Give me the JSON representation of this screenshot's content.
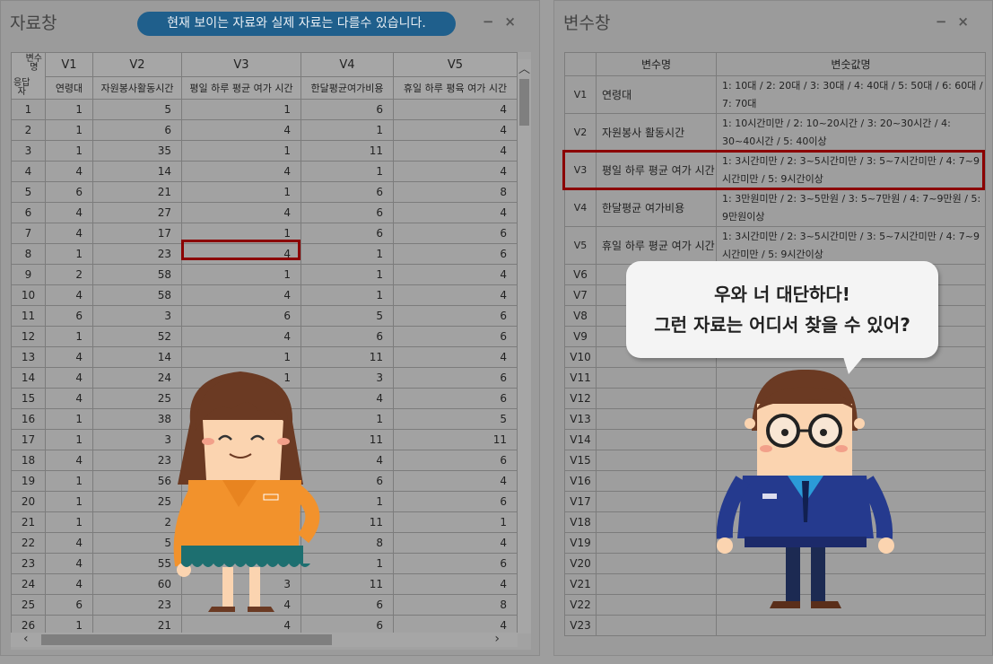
{
  "left_panel": {
    "title": "자료창",
    "notice": "현재 보이는 자료와 실제 자료는 다를수 있습니다.",
    "minimize": "−",
    "close": "×",
    "corner_top": "변수\n명",
    "corner_bottom": "응답\n자",
    "columns": [
      "V1",
      "V2",
      "V3",
      "V4",
      "V5"
    ],
    "column_labels": [
      "연령대",
      "자원봉사활동시간",
      "평일 하루 평균 여가 시간",
      "한달평균여가비용",
      "휴일 하루 평육 여가 시간"
    ],
    "rows": [
      [
        "1",
        "1",
        "5",
        "1",
        "6",
        "4"
      ],
      [
        "2",
        "1",
        "6",
        "4",
        "1",
        "4"
      ],
      [
        "3",
        "1",
        "35",
        "1",
        "11",
        "4"
      ],
      [
        "4",
        "4",
        "14",
        "4",
        "1",
        "4"
      ],
      [
        "5",
        "6",
        "21",
        "1",
        "6",
        "8"
      ],
      [
        "6",
        "4",
        "27",
        "4",
        "6",
        "4"
      ],
      [
        "7",
        "4",
        "17",
        "1",
        "6",
        "6"
      ],
      [
        "8",
        "1",
        "23",
        "4",
        "1",
        "6"
      ],
      [
        "9",
        "2",
        "58",
        "1",
        "1",
        "4"
      ],
      [
        "10",
        "4",
        "58",
        "4",
        "1",
        "4"
      ],
      [
        "11",
        "6",
        "3",
        "6",
        "5",
        "6"
      ],
      [
        "12",
        "1",
        "52",
        "4",
        "6",
        "6"
      ],
      [
        "13",
        "4",
        "14",
        "1",
        "11",
        "4"
      ],
      [
        "14",
        "4",
        "24",
        "1",
        "3",
        "6"
      ],
      [
        "15",
        "4",
        "25",
        "",
        "4",
        "6"
      ],
      [
        "16",
        "1",
        "38",
        "",
        "1",
        "5"
      ],
      [
        "17",
        "1",
        "3",
        "",
        "11",
        "11"
      ],
      [
        "18",
        "4",
        "23",
        "",
        "4",
        "6"
      ],
      [
        "19",
        "1",
        "56",
        "",
        "6",
        "4"
      ],
      [
        "20",
        "1",
        "25",
        "",
        "1",
        "6"
      ],
      [
        "21",
        "1",
        "2",
        "",
        "11",
        "1"
      ],
      [
        "22",
        "4",
        "5",
        "",
        "8",
        "4"
      ],
      [
        "23",
        "4",
        "55",
        "",
        "1",
        "6"
      ],
      [
        "24",
        "4",
        "60",
        "3",
        "11",
        "4"
      ],
      [
        "25",
        "6",
        "23",
        "4",
        "6",
        "8"
      ],
      [
        "26",
        "1",
        "21",
        "4",
        "6",
        "4"
      ]
    ]
  },
  "right_panel": {
    "title": "변수창",
    "minimize": "−",
    "close": "×",
    "headers": [
      "변수명",
      "변숫값명"
    ],
    "variables": [
      {
        "id": "V1",
        "name": "연령대",
        "values": "1: 10대 / 2: 20대 / 3: 30대 / 4: 40대 / 5: 50대 / 6: 60대 / 7: 70대"
      },
      {
        "id": "V2",
        "name": "자원봉사 활동시간",
        "values": "1: 10시간미만 / 2: 10~20시간 / 3: 20~30시간 / 4: 30~40시간 / 5: 40이상"
      },
      {
        "id": "V3",
        "name": "평일 하루 평균 여가 시간",
        "values": "1: 3시간미만 / 2: 3~5시간미만 / 3: 5~7시간미만 / 4: 7~9시간미만 / 5: 9시간이상"
      },
      {
        "id": "V4",
        "name": "한달평균 여가비용",
        "values": "1: 3만원미만 / 2: 3~5만원 / 3: 5~7만원 / 4: 7~9만원 / 5: 9만원이상"
      },
      {
        "id": "V5",
        "name": "휴일 하루 평균 여가 시간",
        "values": "1: 3시간미만 / 2: 3~5시간미만 / 3: 5~7시간미만 / 4: 7~9시간미만 / 5: 9시간이상"
      }
    ],
    "empty_ids": [
      "V6",
      "V7",
      "V8",
      "V9",
      "V10",
      "V11",
      "V12",
      "V13",
      "V14",
      "V15",
      "V16",
      "V17",
      "V18",
      "V19",
      "V20",
      "V21",
      "V22",
      "V23"
    ]
  },
  "speech": {
    "line1": "우와 너 대단하다!",
    "line2": "그런 자료는 어디서 찾을 수 있어?"
  },
  "colors": {
    "highlight": "#8b0000",
    "notice_bg": "#1f5f8c",
    "girl_shirt": "#f2922c",
    "girl_skirt": "#1d6f70",
    "boy_suit": "#253a8e"
  }
}
